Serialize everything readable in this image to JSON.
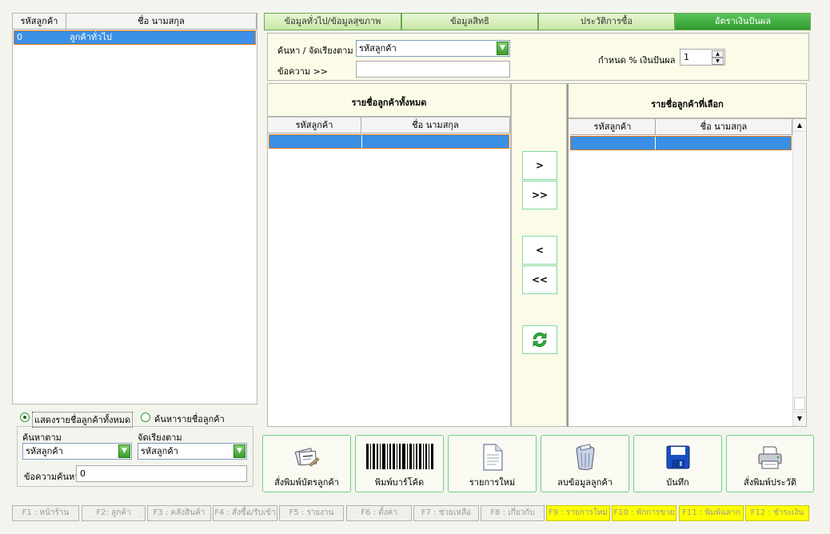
{
  "left_panel": {
    "columns": [
      "รหัสลูกค้า",
      "ชื่อ นามสกุล"
    ],
    "rows": [
      {
        "code": "0",
        "name": "ลูกค้าทั่วไป"
      }
    ],
    "radio_show_all": "แสดงรายชื่อลูกค้าทั้งหมด",
    "radio_search": "ค้นหารายชื่อลูกค้า",
    "search_by_label": "ค้นหาตาม",
    "search_by_value": "รหัสลูกค้า",
    "sort_by_label": "จัดเรียงตาม",
    "sort_by_value": "รหัสลูกค้า",
    "search_text_label": "ข้อความค้นหา",
    "search_text_value": "0"
  },
  "tabs": [
    "ข้อมูลทั่วไป/ข้อมูลสุขภาพ",
    "ข้อมูลสิทธิ",
    "ประวัติการซื้อ",
    "อัตราเงินปันผล"
  ],
  "form": {
    "search_sort_label": "ค้นหา / จัดเรียงตาม",
    "search_sort_value": "รหัสลูกค้า",
    "text_label": "ข้อความ >>",
    "text_value": "",
    "dividend_label": "กำหนด % เงินปันผล",
    "dividend_value": "1"
  },
  "all_customers": {
    "title": "รายชื่อลูกค้าทั้งหมด",
    "columns": [
      "รหัสลูกค้า",
      "ชื่อ นามสกุล"
    ]
  },
  "selected_customers": {
    "title": "รายชื่อลูกค้าที่เลือก",
    "columns": [
      "รหัสลูกค้า",
      "ชื่อ นามสกุล"
    ]
  },
  "move_buttons": {
    "add_one": ">",
    "add_all": ">>",
    "remove_one": "<",
    "remove_all": "<<"
  },
  "actions": {
    "print_card": "สั่งพิมพ์บัตรลูกค้า",
    "print_barcode": "พิมพ์บาร์โค้ด",
    "new_item": "รายการใหม่",
    "delete_customer": "ลบข้อมูลลูกค้า",
    "save": "บันทึก",
    "print_history": "สั่งพิมพ์ประวัติ"
  },
  "function_keys": [
    {
      "label": "F1 : หน้าร้าน",
      "highlight": false
    },
    {
      "label": "F2: ลูกค้า",
      "highlight": false
    },
    {
      "label": "F3 : คลังสินค้า",
      "highlight": false
    },
    {
      "label": "F4 : สั่งซื้อ/รับเข้า",
      "highlight": false
    },
    {
      "label": "F5 : รายงาน",
      "highlight": false
    },
    {
      "label": "F6 : ตั้งค่า",
      "highlight": false
    },
    {
      "label": "F7 : ช่วยเหลือ",
      "highlight": false
    },
    {
      "label": "F8 : เกี่ยวกับ",
      "highlight": false
    },
    {
      "label": "F9 : รายการใหม่",
      "highlight": true
    },
    {
      "label": "F10 : พักการขาย",
      "highlight": true
    },
    {
      "label": "F11 : พิมพ์ฉลาก",
      "highlight": true
    },
    {
      "label": "F12 : ชำระเงิน",
      "highlight": true
    }
  ],
  "colors": {
    "selection": "#3b8fe4",
    "tab_active": "#2e9a2e",
    "button_border": "#6fd17f",
    "fkey_highlight": "#ffff00"
  }
}
